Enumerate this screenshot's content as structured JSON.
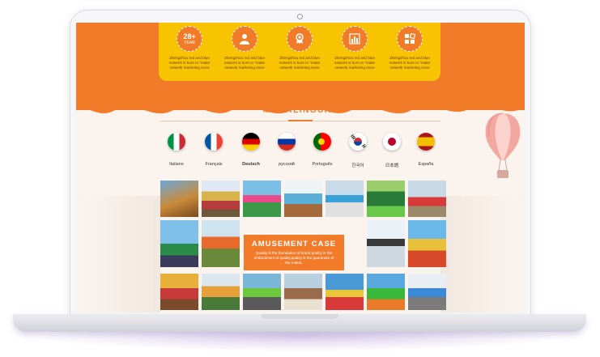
{
  "features": [
    {
      "icon": "year-badge-icon",
      "badge_big": "28+",
      "badge_small": "YEAR",
      "text": "Zhengzhou red and blue network is born to \"make network marketing more"
    },
    {
      "icon": "person-icon",
      "text": "Zhengzhou red and blue network is born to \"make network marketing more"
    },
    {
      "icon": "award-medal-icon",
      "text": "Zhengzhou red and blue network is born to \"make network marketing more"
    },
    {
      "icon": "bar-chart-icon",
      "text": "Zhengzhou red and blue network is born to \"make network marketing more"
    },
    {
      "icon": "grid-blocks-icon",
      "text": "Zhengzhou red and blue network is born to \"make network marketing more"
    }
  ],
  "multilingual": {
    "title": "MULTILINGUAL",
    "languages": [
      {
        "label": "Italiano",
        "flag": "italy-flag-icon",
        "colors": [
          "#009246",
          "#ffffff",
          "#ce2b37"
        ]
      },
      {
        "label": "Français",
        "flag": "france-flag-icon",
        "colors": [
          "#0055a4",
          "#ffffff",
          "#ef4135"
        ]
      },
      {
        "label": "Deutsch",
        "flag": "germany-flag-icon",
        "colors": [
          "#000000",
          "#dd0000",
          "#ffce00"
        ]
      },
      {
        "label": "русский",
        "flag": "russia-flag-icon",
        "colors": [
          "#ffffff",
          "#0039a6",
          "#d52b1e"
        ]
      },
      {
        "label": "Português",
        "flag": "portugal-flag-icon",
        "colors": [
          "#006600",
          "#ff0000"
        ]
      },
      {
        "label": "한국어",
        "flag": "korea-flag-icon",
        "colors": [
          "#ffffff",
          "#cd2e3a",
          "#0047a0"
        ]
      },
      {
        "label": "日本語",
        "flag": "japan-flag-icon",
        "colors": [
          "#ffffff",
          "#bc002d"
        ]
      },
      {
        "label": "España",
        "flag": "spain-flag-icon",
        "colors": [
          "#aa151b",
          "#f1bf00"
        ]
      }
    ]
  },
  "amusement_case": {
    "title": "AMUSEMENT CASE",
    "text": "Quality is the foundation of brand,quality  is the embodiment of quality,quality is the guarantee  of the maket."
  },
  "colors": {
    "brand_orange": "#f27b2a",
    "brand_yellow": "#f8c300",
    "background": "#fbf4ee"
  }
}
